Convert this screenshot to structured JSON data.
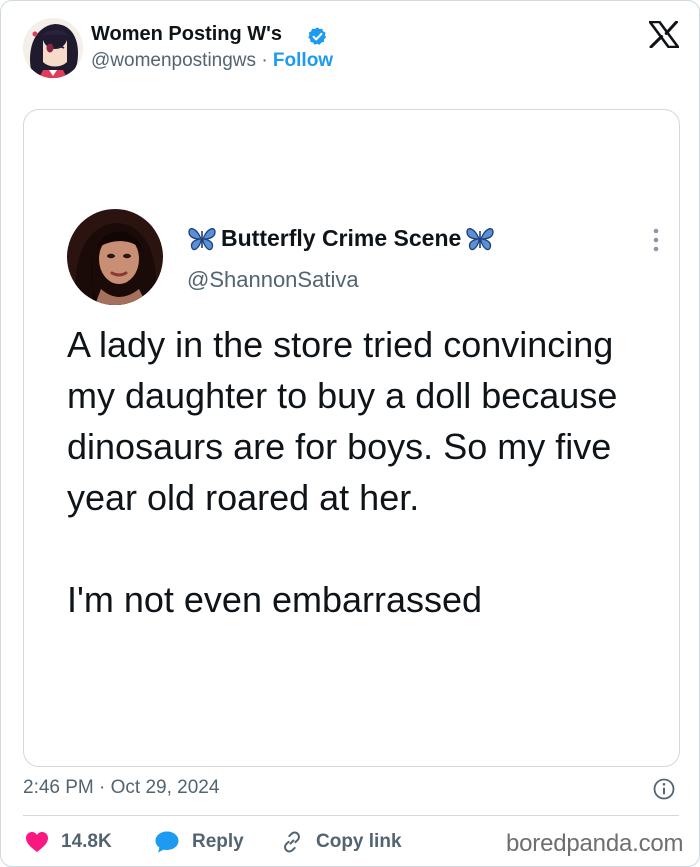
{
  "author": {
    "display_name": "Women Posting W's",
    "handle": "@womenpostingws",
    "separator": "·",
    "follow_label": "Follow",
    "verified": true
  },
  "embedded_tweet": {
    "display_name": "Butterfly Crime Scene",
    "handle": "@ShannonSativa",
    "text": "A lady in the store tried convincing my daughter to buy a doll because dinosaurs are for boys. So my five year old roared at her.\n\nI'm not even embarrassed"
  },
  "meta": {
    "timestamp": "2:46 PM · Oct 29, 2024"
  },
  "actions": {
    "like_count": "14.8K",
    "reply_label": "Reply",
    "copy_label": "Copy link"
  },
  "watermark": "boredpanda.com",
  "icons": {
    "brand": "x-logo-icon",
    "verified": "verified-badge-icon",
    "like": "heart-icon",
    "reply": "speech-bubble-icon",
    "copy": "link-icon",
    "info": "info-icon",
    "more": "kebab-menu-icon",
    "decoration": "butterfly-icon"
  },
  "colors": {
    "accent": "#1d9bf0",
    "like": "#f91880",
    "text": "#0f1419",
    "secondary": "#536471",
    "border": "#cfd9de"
  }
}
